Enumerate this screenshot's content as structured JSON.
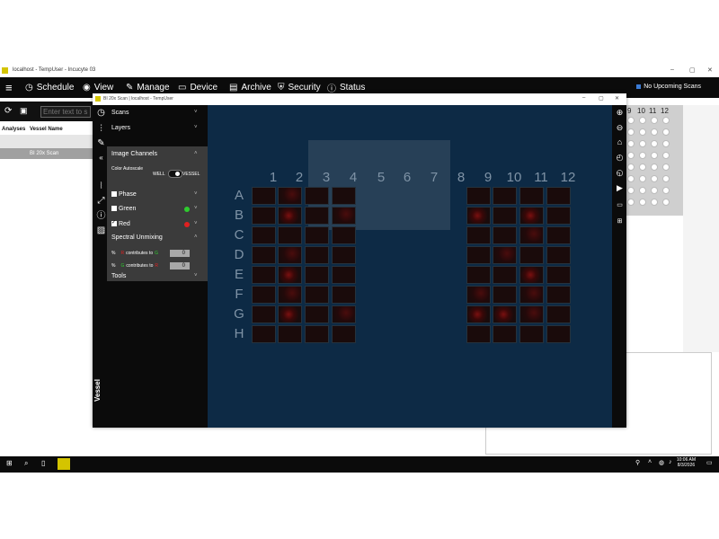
{
  "outer_window": {
    "title": "localhost - TempUser - Incucyte 03",
    "controls": {
      "minimize": "–",
      "maximize": "▢",
      "close": "✕"
    }
  },
  "menu": {
    "hamburger": "≡",
    "items": [
      {
        "label": "Schedule",
        "icon": "clock-icon",
        "glyph": "◷"
      },
      {
        "label": "View",
        "icon": "eye-icon",
        "glyph": "◉"
      },
      {
        "label": "Manage",
        "icon": "wrench-icon",
        "glyph": "✎"
      },
      {
        "label": "Device",
        "icon": "device-icon",
        "glyph": "▭"
      },
      {
        "label": "Archive",
        "icon": "archive-icon",
        "glyph": "▤"
      },
      {
        "label": "Security",
        "icon": "shield-icon",
        "glyph": "⛨"
      },
      {
        "label": "Status",
        "icon": "info-icon",
        "glyph": "ⓘ"
      }
    ],
    "upcoming": "No Upcoming Scans"
  },
  "left_toolbar": {
    "search_placeholder": "Enter text to s",
    "columns": [
      "Analyses",
      "Vessel Name"
    ],
    "row_value": "BI 20x Scan"
  },
  "inner_window": {
    "title": "BI 20x Scan | localhost - TempUser",
    "sections": {
      "scans": "Scans",
      "layers": "Layers",
      "image_channels": "Image Channels",
      "color_autoscale": "Color Autoscale",
      "well": "WELL",
      "vessel": "VESSEL",
      "phase": "Phase",
      "green": "Green",
      "red": "Red",
      "spectral_unmixing": "Spectral Unmixing",
      "tools": "Tools",
      "vessel_label": "Vessel"
    },
    "unmix": [
      {
        "pct": "%",
        "from": "R",
        "text": "contributes to",
        "to": "G",
        "value": "0"
      },
      {
        "pct": "%",
        "from": "G",
        "text": "contributes to",
        "to": "R",
        "value": "0"
      }
    ],
    "channels": {
      "phase_checked": false,
      "green_checked": false,
      "red_checked": true
    },
    "colors": {
      "green_dot": "#2ecc2e",
      "red_dot": "#e02020",
      "viewer_bg": "#0d2a45"
    }
  },
  "plate": {
    "columns": [
      "1",
      "2",
      "3",
      "4",
      "5",
      "6",
      "7",
      "8",
      "9",
      "10",
      "11",
      "12"
    ],
    "rows": [
      "A",
      "B",
      "C",
      "D",
      "E",
      "F",
      "G",
      "H"
    ]
  },
  "right_plate": {
    "columns": [
      "9",
      "10",
      "11",
      "12"
    ]
  },
  "taskbar": {
    "time": "10:06 AM",
    "date": "8/3/2026"
  }
}
